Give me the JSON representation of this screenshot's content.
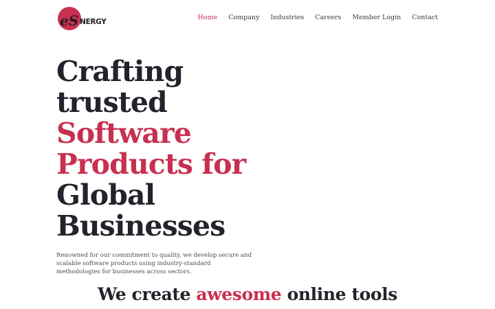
{
  "brand": {
    "logo_letters": "eS",
    "logo_word": "NERGY",
    "accent_color": "#c8304f",
    "text_color": "#22232b"
  },
  "nav": {
    "items": [
      {
        "label": "Home",
        "active": true
      },
      {
        "label": "Company",
        "active": false
      },
      {
        "label": "Industries",
        "active": false
      },
      {
        "label": "Careers",
        "active": false
      },
      {
        "label": "Member Login",
        "active": false
      },
      {
        "label": "Contact",
        "active": false
      }
    ]
  },
  "hero": {
    "line1": "Crafting",
    "line2": "trusted",
    "line3": "Software",
    "line4": "Products for",
    "line5": "Global",
    "line6": "Businesses"
  },
  "intro": {
    "text": "Renowned for our commitment to quality, we develop secure and scalable software products using industry-standard methodologies for businesses across sectors."
  },
  "tools": {
    "before": "We create ",
    "accent": "awesome",
    "after": " online tools"
  }
}
